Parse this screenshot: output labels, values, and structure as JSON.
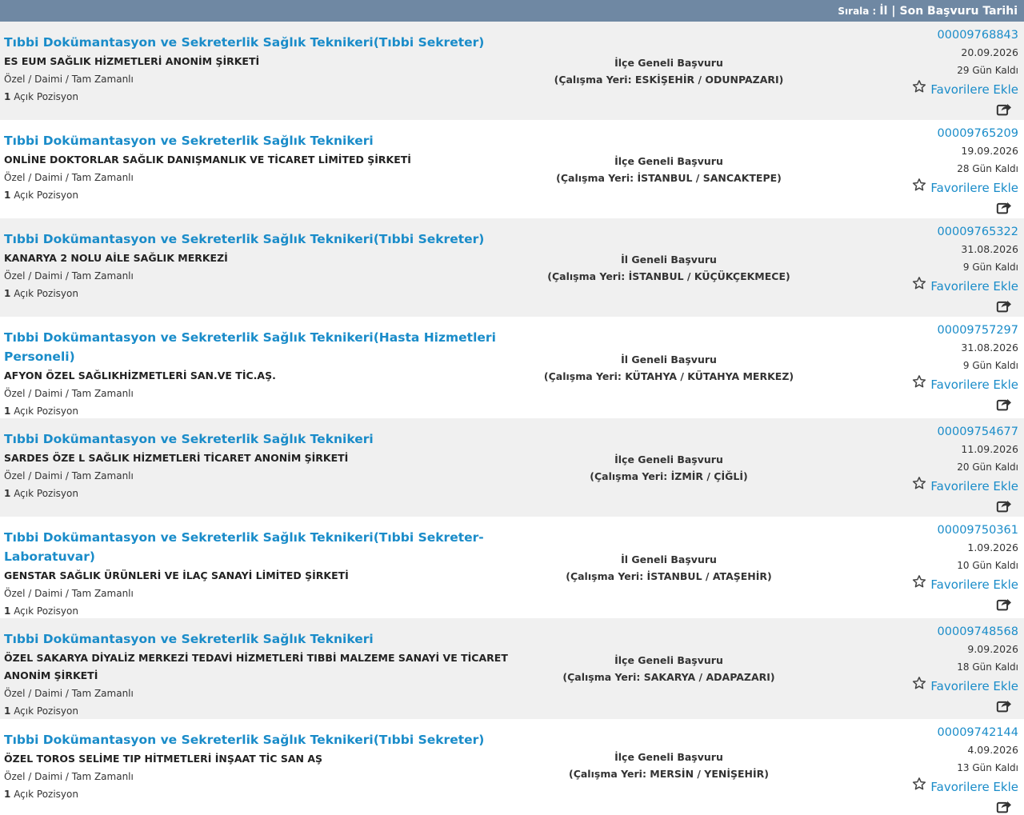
{
  "sort": {
    "label": "Sırala :",
    "option_il": "İl",
    "separator": "|",
    "option_date": "Son Başvuru Tarihi"
  },
  "listings": [
    {
      "title": "Tıbbi Dokümantasyon ve Sekreterlik Sağlık Teknikeri(Tıbbi Sekreter)",
      "company": "ES EUM SAĞLIK HİZMETLERİ ANONİM ŞİRKETİ",
      "meta": "Özel / Daimi / Tam Zamanlı",
      "positions_count": "1",
      "positions_label": "Açık Pozisyon",
      "apply_scope": "İlçe Geneli Başvuru",
      "workplace": "(Çalışma Yeri: ESKİŞEHİR / ODUNPAZARI)",
      "ilan_no": "00009768843",
      "deadline": "20.09.2026",
      "days_left": "29 Gün Kaldı",
      "fav_label": "Favorilere Ekle"
    },
    {
      "title": "Tıbbi Dokümantasyon ve Sekreterlik Sağlık Teknikeri",
      "company": "ONLİNE DOKTORLAR SAĞLIK DANIŞMANLIK VE TİCARET LİMİTED ŞİRKETİ",
      "meta": "Özel / Daimi / Tam Zamanlı",
      "positions_count": "1",
      "positions_label": "Açık Pozisyon",
      "apply_scope": "İlçe Geneli Başvuru",
      "workplace": "(Çalışma Yeri: İSTANBUL / SANCAKTEPE)",
      "ilan_no": "00009765209",
      "deadline": "19.09.2026",
      "days_left": "28 Gün Kaldı",
      "fav_label": "Favorilere Ekle"
    },
    {
      "title": "Tıbbi Dokümantasyon ve Sekreterlik Sağlık Teknikeri(Tıbbi Sekreter)",
      "company": "KANARYA 2 NOLU AİLE SAĞLIK MERKEZİ",
      "meta": "Özel / Daimi / Tam Zamanlı",
      "positions_count": "1",
      "positions_label": "Açık Pozisyon",
      "apply_scope": "İl Geneli Başvuru",
      "workplace": "(Çalışma Yeri: İSTANBUL / KÜÇÜKÇEKMECE)",
      "ilan_no": "00009765322",
      "deadline": "31.08.2026",
      "days_left": "9 Gün Kaldı",
      "fav_label": "Favorilere Ekle"
    },
    {
      "title": "Tıbbi Dokümantasyon ve Sekreterlik Sağlık Teknikeri(Hasta Hizmetleri Personeli)",
      "company": "AFYON ÖZEL SAĞLIKHİZMETLERİ SAN.VE TİC.AŞ.",
      "meta": "Özel / Daimi / Tam Zamanlı",
      "positions_count": "1",
      "positions_label": "Açık Pozisyon",
      "apply_scope": "İl Geneli Başvuru",
      "workplace": "(Çalışma Yeri: KÜTAHYA / KÜTAHYA MERKEZ)",
      "ilan_no": "00009757297",
      "deadline": "31.08.2026",
      "days_left": "9 Gün Kaldı",
      "fav_label": "Favorilere Ekle"
    },
    {
      "title": "Tıbbi Dokümantasyon ve Sekreterlik Sağlık Teknikeri",
      "company": "SARDES ÖZE L SAĞLIK HİZMETLERİ TİCARET ANONİM ŞİRKETİ",
      "meta": "Özel / Daimi / Tam Zamanlı",
      "positions_count": "1",
      "positions_label": "Açık Pozisyon",
      "apply_scope": "İlçe Geneli Başvuru",
      "workplace": "(Çalışma Yeri: İZMİR / ÇİĞLİ)",
      "ilan_no": "00009754677",
      "deadline": "11.09.2026",
      "days_left": "20 Gün Kaldı",
      "fav_label": "Favorilere Ekle"
    },
    {
      "title": "Tıbbi Dokümantasyon ve Sekreterlik Sağlık Teknikeri(Tıbbi Sekreter-Laboratuvar)",
      "company": "GENSTAR SAĞLIK ÜRÜNLERİ VE İLAÇ SANAYİ LİMİTED ŞİRKETİ",
      "meta": "Özel / Daimi / Tam Zamanlı",
      "positions_count": "1",
      "positions_label": "Açık Pozisyon",
      "apply_scope": "İl Geneli Başvuru",
      "workplace": "(Çalışma Yeri: İSTANBUL / ATAŞEHİR)",
      "ilan_no": "00009750361",
      "deadline": "1.09.2026",
      "days_left": "10 Gün Kaldı",
      "fav_label": "Favorilere Ekle"
    },
    {
      "title": "Tıbbi Dokümantasyon ve Sekreterlik Sağlık Teknikeri",
      "company": "ÖZEL SAKARYA DİYALİZ MERKEZİ TEDAVİ HİZMETLERİ TIBBİ MALZEME SANAYİ VE TİCARET ANONİM ŞİRKETİ",
      "meta": "Özel / Daimi / Tam Zamanlı",
      "positions_count": "1",
      "positions_label": "Açık Pozisyon",
      "apply_scope": "İlçe Geneli Başvuru",
      "workplace": "(Çalışma Yeri: SAKARYA / ADAPAZARI)",
      "ilan_no": "00009748568",
      "deadline": "9.09.2026",
      "days_left": "18 Gün Kaldı",
      "fav_label": "Favorilere Ekle"
    },
    {
      "title": "Tıbbi Dokümantasyon ve Sekreterlik Sağlık Teknikeri(Tıbbi Sekreter)",
      "company": "ÖZEL TOROS SELİME TIP HİTMETLERİ İNŞAAT TİC SAN AŞ",
      "meta": "Özel / Daimi / Tam Zamanlı",
      "positions_count": "1",
      "positions_label": "Açık Pozisyon",
      "apply_scope": "İlçe Geneli Başvuru",
      "workplace": "(Çalışma Yeri: MERSİN / YENİŞEHİR)",
      "ilan_no": "00009742144",
      "deadline": "4.09.2026",
      "days_left": "13 Gün Kaldı",
      "fav_label": "Favorilere Ekle"
    }
  ]
}
